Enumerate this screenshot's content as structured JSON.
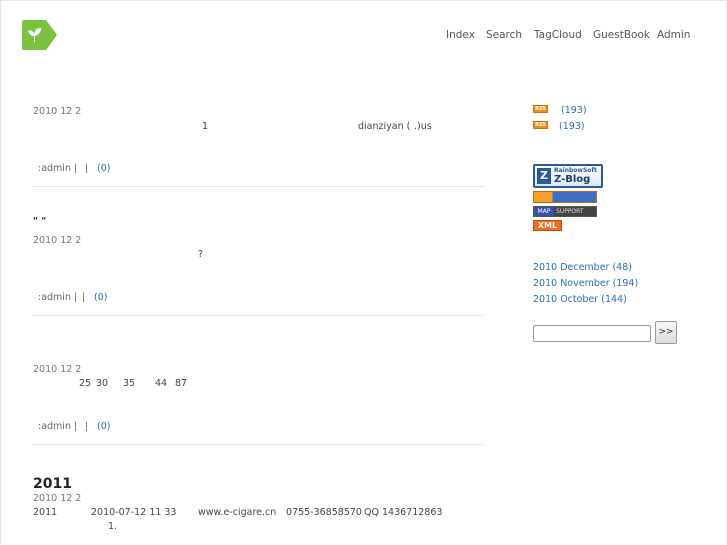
{
  "nav": {
    "items": [
      "Index",
      "Search",
      "TagCloud",
      "GuestBook",
      "Admin"
    ]
  },
  "posts": [
    {
      "date": "2010 12 2",
      "line1_a": "1",
      "line1_b": "dianziyan (",
      "line1_c": ".)us",
      "meta_prefix": ":admin |",
      "meta_sep": "|",
      "comments": "(0)"
    },
    {
      "title": "\"   \"",
      "date": "2010 12 2",
      "line1": "?",
      "meta_prefix": ":admin |",
      "meta_sep": "|",
      "comments": "(0)"
    },
    {
      "date": "2010 12 2",
      "nums": [
        "25",
        "30",
        "35",
        "44",
        "87"
      ],
      "meta_prefix": ":admin |",
      "meta_sep": "|",
      "comments": "(0)"
    },
    {
      "title": "2011",
      "date": "2010 12 2",
      "line1": [
        "2011",
        "2010-07-12 11 33",
        "www.e-cigare.cn",
        "0755-36858570",
        "QQ 1436712863"
      ],
      "line2": "1."
    }
  ],
  "sidebar": {
    "rss_label": "RSS",
    "feeds": [
      "(193)",
      "(193)"
    ],
    "badges": {
      "zblog_top": "RainbowSoft",
      "zblog_main": "Z-Blog",
      "map_left": "MAP",
      "map_right": "SUPPORT",
      "xml": "XML"
    },
    "archives": [
      "2010 December (48)",
      "2010 November (194)",
      "2010 October (144)"
    ],
    "search": {
      "value": "",
      "button": ">>"
    }
  },
  "colors": {
    "link": "#2a6db5",
    "logo": "#7cc242",
    "rss": "#f08c1b"
  }
}
